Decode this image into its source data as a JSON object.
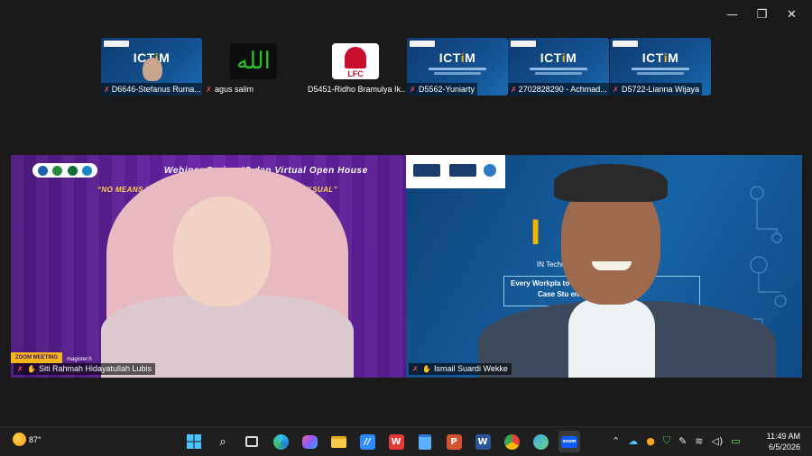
{
  "window_controls": {
    "minimize": "—",
    "restore": "❐",
    "close": "✕"
  },
  "participants": [
    {
      "name": "D6646-Stefanus Ruma...",
      "kind": "slide"
    },
    {
      "name": "agus salim",
      "kind": "allah"
    },
    {
      "name": "D5451-Ridho Bramulya Ik...",
      "kind": "lfc"
    },
    {
      "name": "D5562-Yuniarty",
      "kind": "slide"
    },
    {
      "name": "2702828290 - Achmad...",
      "kind": "slide"
    },
    {
      "name": "D5722-Lianna Wijaya",
      "kind": "slide"
    }
  ],
  "thumb_slide": {
    "title_a": "ICT",
    "title_b": "i",
    "title_c": "M"
  },
  "avatars": {
    "allah_text": "الله",
    "lfc_text": "LFC"
  },
  "tile_left": {
    "speaker": "Siti Rahmah Hidayatullah Lubis",
    "title": "Webinar Series #2 dan Virtual Open House",
    "subtitle": "“NO MEANS NO: MEMBANG         ACE DARI KEKERASAN SEKSUAL”",
    "zoom_label": "ZOOM MEETING",
    "url": "magister.h"
  },
  "tile_right": {
    "speaker": "Ismail Suardi Wekke",
    "big_letter": "I",
    "big_letter2": "I",
    "line1": "IN           Techno                            ent",
    "line2": "Every Workpla                     to Academic",
    "line3": "Case Stu                 enter"
  },
  "taskbar": {
    "temperature": "87°",
    "time": "11:49 AM",
    "date": "6/5/2026",
    "apps": [
      "start",
      "search",
      "task-view",
      "edge",
      "copilot",
      "file-explorer",
      "zoom-workplace",
      "wps",
      "notepad",
      "powerpoint",
      "word",
      "chrome",
      "photos",
      "zoom"
    ],
    "tray": [
      "chevron-up",
      "onedrive",
      "app-tray",
      "defender",
      "pen",
      "wifi",
      "volume",
      "battery"
    ]
  },
  "colors": {
    "accent_gold": "#f4b400",
    "mic_off": "#ff4d4d",
    "purple": "#6a23a8",
    "blue": "#1863a6"
  }
}
